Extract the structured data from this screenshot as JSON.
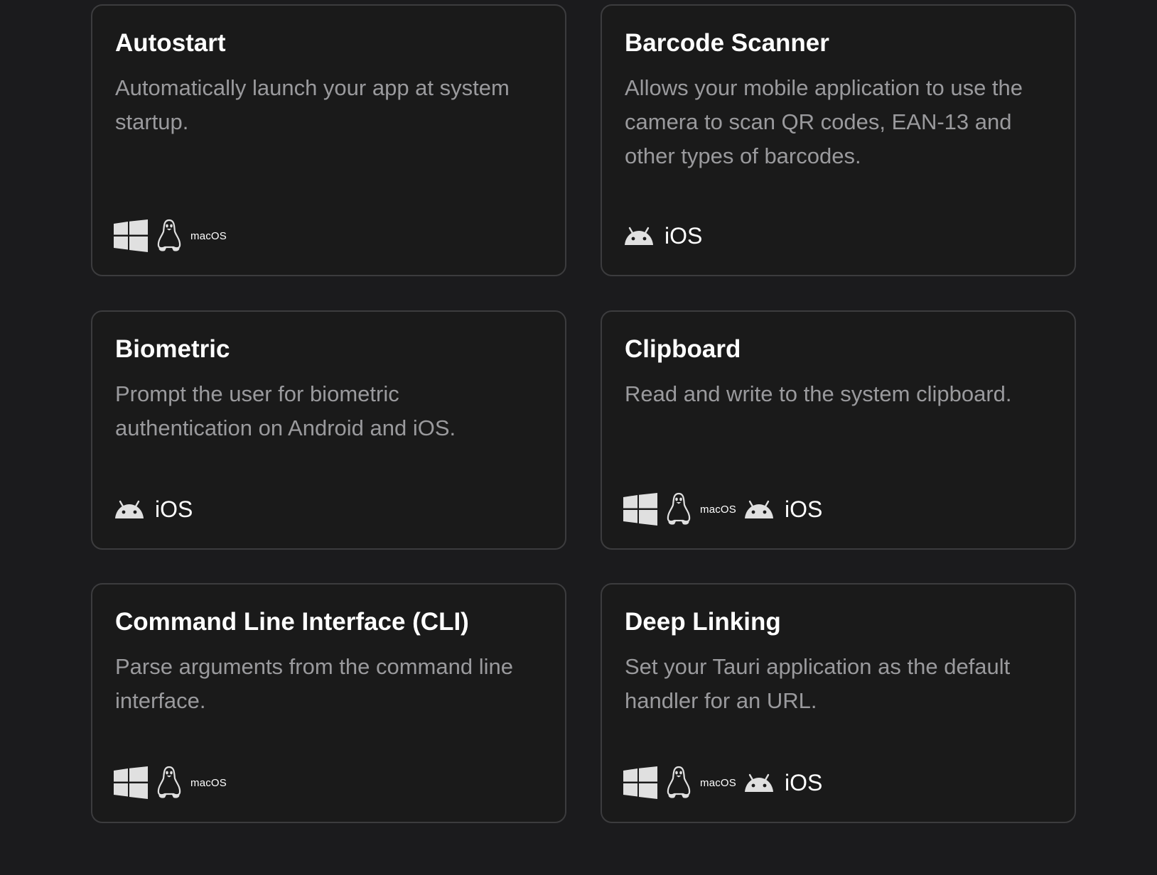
{
  "cards": [
    {
      "title": "Autostart",
      "description": "Automatically launch your app at system startup.",
      "platforms": [
        "windows-icon",
        "linux-icon",
        "macos"
      ]
    },
    {
      "title": "Barcode Scanner",
      "description": "Allows your mobile application to use the camera to scan QR codes, EAN-13 and other types of barcodes.",
      "platforms": [
        "android-icon",
        "ios"
      ]
    },
    {
      "title": "Biometric",
      "description": "Prompt the user for biometric authentication on Android and iOS.",
      "platforms": [
        "android-icon",
        "ios"
      ]
    },
    {
      "title": "Clipboard",
      "description": "Read and write to the system clipboard.",
      "platforms": [
        "windows-icon",
        "linux-icon",
        "macos",
        "android-icon",
        "ios"
      ]
    },
    {
      "title": "Command Line Interface (CLI)",
      "description": "Parse arguments from the command line interface.",
      "platforms": [
        "windows-icon",
        "linux-icon",
        "macos"
      ]
    },
    {
      "title": "Deep Linking",
      "description": "Set your Tauri application as the default handler for an URL.",
      "platforms": [
        "windows-icon",
        "linux-icon",
        "macos",
        "android-icon",
        "ios"
      ]
    }
  ],
  "platform_labels": {
    "macos": "macOS",
    "ios": "iOS"
  },
  "colors": {
    "background": "#1b1b1d",
    "card_background": "#1a1a1a",
    "card_border": "#3c3c3e",
    "title": "#ffffff",
    "description": "#9a9a9d",
    "icon": "#e0e0e0"
  }
}
